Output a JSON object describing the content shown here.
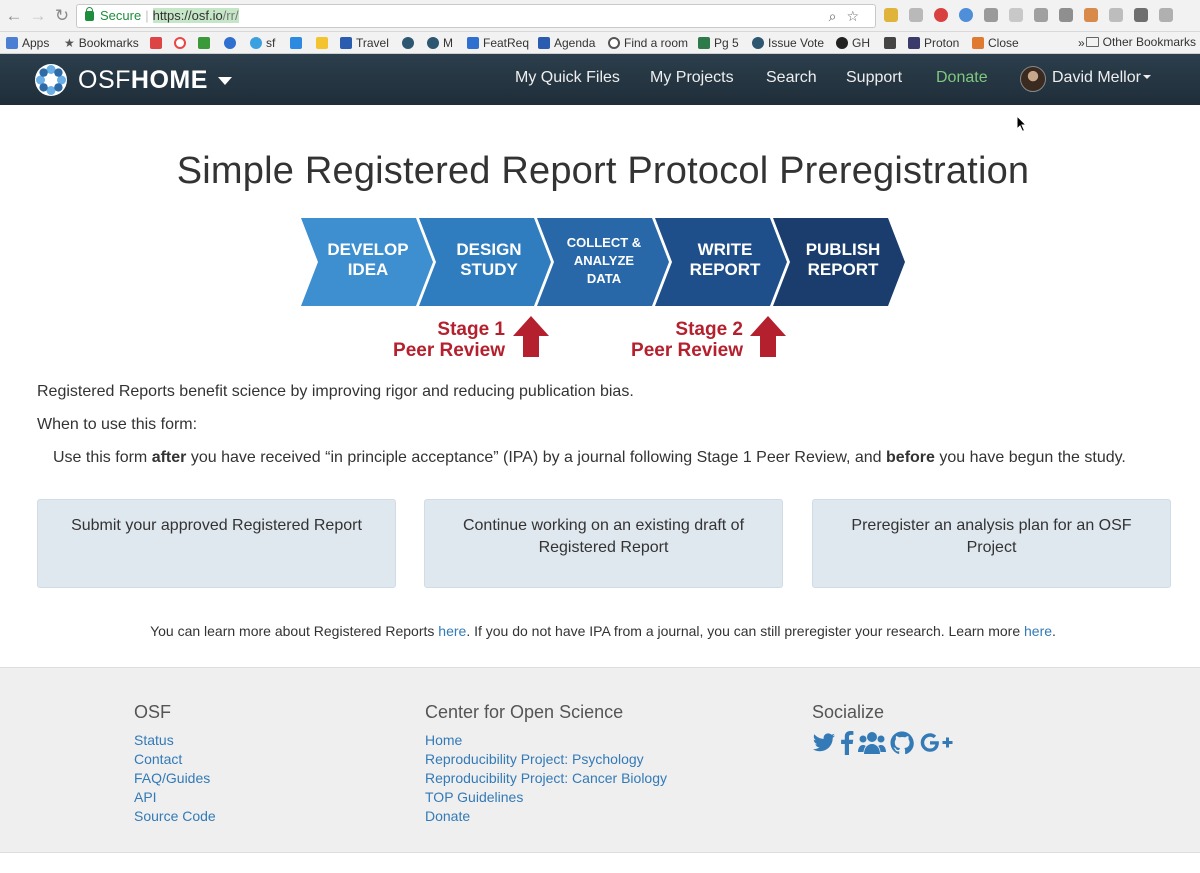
{
  "browser": {
    "secure_label": "Secure",
    "url_host": "https://osf.io",
    "url_path": "/rr/",
    "bookmarks": [
      "Apps",
      "Bookmarks",
      "sf",
      "Travel",
      "M",
      "FeatReq",
      "Agenda",
      "Find a room",
      "Pg 5",
      "Issue Vote",
      "GH",
      "Proton",
      "Close"
    ],
    "other_bookmarks": "Other Bookmarks",
    "more_indicator": "»"
  },
  "navbar": {
    "brand_osf": "OSF",
    "brand_home": "HOME",
    "links": [
      "My Quick Files",
      "My Projects",
      "Search",
      "Support",
      "Donate"
    ],
    "user_name": "David Mellor"
  },
  "main": {
    "title": "Simple Registered Report Protocol Preregistration",
    "flow_steps": [
      [
        "DEVELOP",
        "IDEA"
      ],
      [
        "DESIGN",
        "STUDY"
      ],
      [
        "COLLECT &",
        "ANALYZE",
        "DATA"
      ],
      [
        "WRITE",
        "REPORT"
      ],
      [
        "PUBLISH",
        "REPORT"
      ]
    ],
    "review_1": [
      "Stage 1",
      "Peer Review"
    ],
    "review_2": [
      "Stage 2",
      "Peer Review"
    ],
    "intro": "Registered Reports benefit science by improving rigor and reducing publication bias.",
    "when_label": "When to use this form:",
    "usage_pre": "Use this form ",
    "usage_after": "after",
    "usage_mid": " you have received “in principle acceptance” (IPA) by a journal following Stage 1 Peer Review, and ",
    "usage_before": "before",
    "usage_end": " you have begun the study.",
    "options": [
      "Submit your approved Registered Report",
      "Continue working on an existing draft of Registered Report",
      "Preregister an analysis plan for an OSF Project"
    ],
    "footnote_1": "You can learn more about Registered Reports ",
    "footnote_link_1": "here",
    "footnote_2": ". If you do not have IPA from a journal, you can still preregister your research. Learn more ",
    "footnote_link_2": "here",
    "footnote_3": "."
  },
  "footer": {
    "osf_heading": "OSF",
    "osf_links": [
      "Status",
      "Contact",
      "FAQ/Guides",
      "API",
      "Source Code"
    ],
    "cos_heading": "Center for Open Science",
    "cos_links": [
      "Home",
      "Reproducibility Project: Psychology",
      "Reproducibility Project: Cancer Biology",
      "TOP Guidelines",
      "Donate"
    ],
    "social_heading": "Socialize",
    "social_icons": [
      "twitter-icon",
      "facebook-icon",
      "group-icon",
      "github-icon",
      "google-plus-icon"
    ]
  },
  "colors": {
    "navbar": "#263947",
    "link": "#337ab7",
    "donate": "#7fc87f",
    "option_bg": "#dfe7ef",
    "review_red": "#b5202e",
    "flow_steps": [
      "#3d8fcf",
      "#2f7cbf",
      "#2968a8",
      "#1f4f8a",
      "#1a3d6e"
    ]
  }
}
